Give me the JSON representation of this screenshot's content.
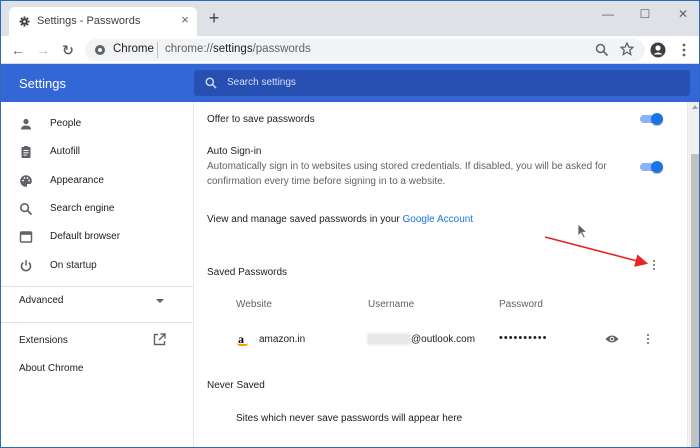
{
  "tab": {
    "title": "Settings - Passwords",
    "close_glyph": "×",
    "new_tab_glyph": "+"
  },
  "window_controls": {
    "minimize": "—",
    "maximize": "☐",
    "close": "✕"
  },
  "toolbar": {
    "back_glyph": "←",
    "forward_glyph": "→",
    "reload_glyph": "↻"
  },
  "omnibox": {
    "site_name": "Chrome",
    "url_scheme": "chrome://",
    "url_host": "settings",
    "url_path": "/passwords"
  },
  "header": {
    "title": "Settings",
    "search_placeholder": "Search settings"
  },
  "sidebar": {
    "items": [
      {
        "label": "People",
        "icon": "person-icon"
      },
      {
        "label": "Autofill",
        "icon": "clipboard-icon"
      },
      {
        "label": "Appearance",
        "icon": "palette-icon"
      },
      {
        "label": "Search engine",
        "icon": "search-icon"
      },
      {
        "label": "Default browser",
        "icon": "browser-icon"
      },
      {
        "label": "On startup",
        "icon": "power-icon"
      }
    ],
    "advanced": "Advanced",
    "extensions": "Extensions",
    "about": "About Chrome"
  },
  "passwords": {
    "offer_to_save": {
      "label": "Offer to save passwords",
      "enabled": true
    },
    "auto_signin": {
      "label": "Auto Sign-in",
      "description_line1": "Automatically sign in to websites using stored credentials. If disabled, you will be asked for",
      "description_line2": "confirmation every time before signing in to a website.",
      "enabled": true
    },
    "manage_text": "View and manage saved passwords in your ",
    "manage_link": "Google Account",
    "saved_title": "Saved Passwords",
    "columns": {
      "website": "Website",
      "username": "Username",
      "password": "Password"
    },
    "entries": [
      {
        "website": "amazon.in",
        "username_suffix": "@outlook.com",
        "password": "••••••••••"
      }
    ],
    "never_saved_title": "Never Saved",
    "never_saved_empty": "Sites which never save passwords will appear here"
  },
  "colors": {
    "accent": "#3367d6",
    "toggle_on": "#1a73e8",
    "annotation_arrow": "#e52521"
  }
}
